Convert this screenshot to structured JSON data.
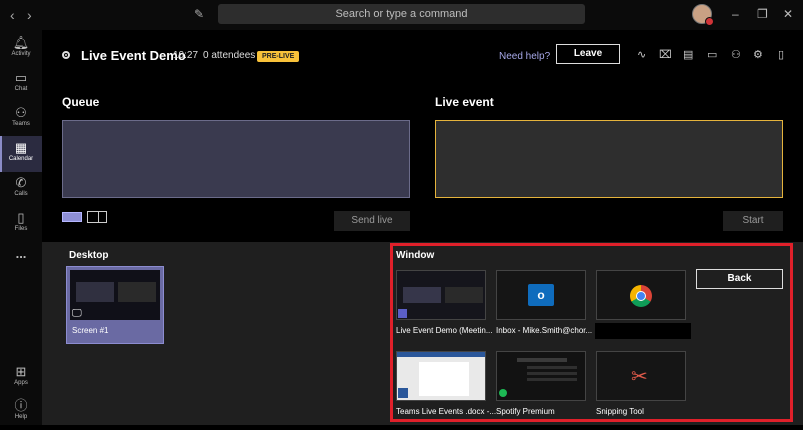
{
  "titlebar": {
    "search_placeholder": "Search or type a command"
  },
  "rail": {
    "items": [
      {
        "label": "Activity",
        "icon": "bell-icon"
      },
      {
        "label": "Chat",
        "icon": "chat-icon"
      },
      {
        "label": "Teams",
        "icon": "teams-icon"
      },
      {
        "label": "Calendar",
        "icon": "calendar-icon"
      },
      {
        "label": "Calls",
        "icon": "phone-icon"
      },
      {
        "label": "Files",
        "icon": "file-icon"
      },
      {
        "label": "...",
        "icon": "more-icon"
      },
      {
        "label": "Apps",
        "icon": "apps-icon"
      },
      {
        "label": "Help",
        "icon": "help-icon"
      }
    ]
  },
  "meeting": {
    "title": "Live Event Demo",
    "time": "10:27",
    "attendees": "0 attendees",
    "badge": "PRE-LIVE",
    "help": "Need help?",
    "leave": "Leave"
  },
  "panels": {
    "queue": "Queue",
    "live_event": "Live event",
    "send_live": "Send live",
    "start": "Start"
  },
  "share": {
    "desktop": "Desktop",
    "screen": "Screen #1",
    "window": "Window",
    "back": "Back",
    "windows": [
      {
        "label": "Live Event Demo (Meetin..."
      },
      {
        "label": "Inbox - Mike.Smith@chor..."
      },
      {
        "label": ""
      },
      {
        "label": "Teams Live Events .docx -..."
      },
      {
        "label": "Spotify Premium"
      },
      {
        "label": "Snipping Tool"
      }
    ]
  },
  "colors": {
    "accent": "#8b8cc7",
    "prelive": "#f8c23a",
    "live_border": "#e5b33c",
    "highlight": "#e0202a"
  }
}
